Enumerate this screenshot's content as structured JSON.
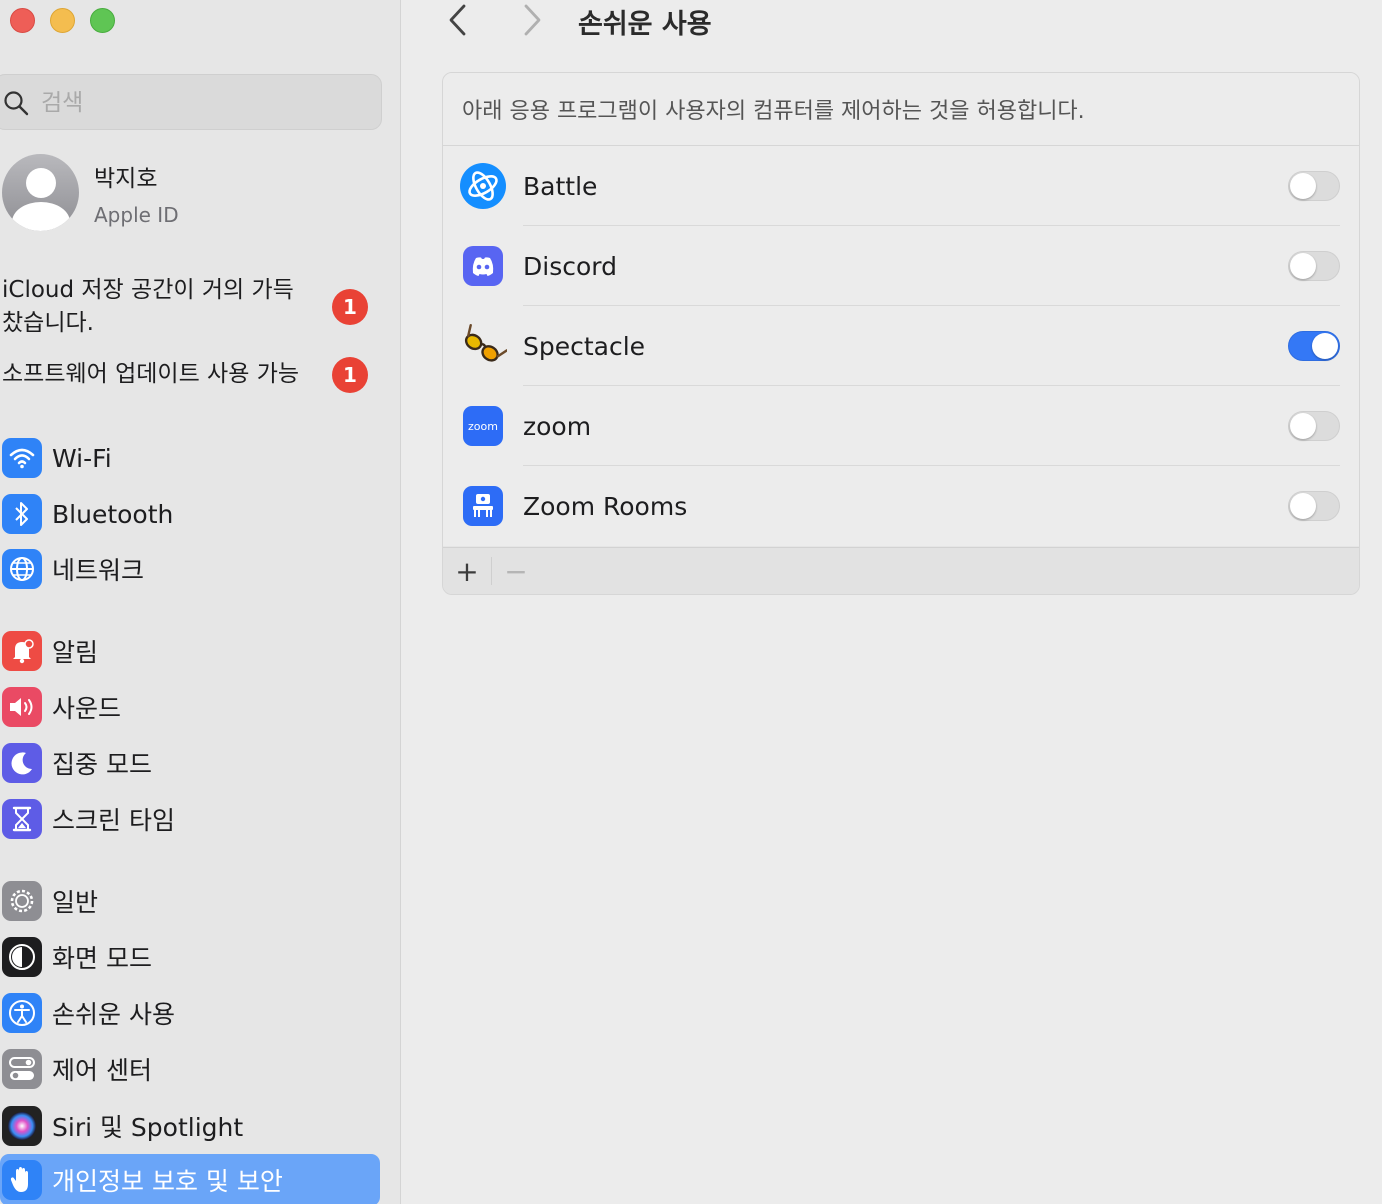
{
  "sidebar": {
    "search_placeholder": "검색",
    "account": {
      "name": "박지호",
      "subtitle": "Apple ID"
    },
    "notices": [
      {
        "label": "iCloud 저장 공간이 거의 가득 찼습니다.",
        "badge": "1"
      },
      {
        "label": "소프트웨어 업데이트 사용 가능",
        "badge": "1"
      }
    ],
    "items": [
      {
        "label": "Wi-Fi",
        "icon": "wifi-icon",
        "color": "#2f83f7"
      },
      {
        "label": "Bluetooth",
        "icon": "bluetooth-icon",
        "color": "#2f83f7"
      },
      {
        "label": "네트워크",
        "icon": "globe-icon",
        "color": "#2f83f7"
      },
      {
        "label": "알림",
        "icon": "bell-icon",
        "color": "#ee4b44"
      },
      {
        "label": "사운드",
        "icon": "speaker-icon",
        "color": "#ea4a64"
      },
      {
        "label": "집중 모드",
        "icon": "moon-icon",
        "color": "#5e5ce6"
      },
      {
        "label": "스크린 타임",
        "icon": "hourglass-icon",
        "color": "#5e5ce6"
      },
      {
        "label": "일반",
        "icon": "gear-icon",
        "color": "#8e8e93"
      },
      {
        "label": "화면 모드",
        "icon": "appearance-icon",
        "color": "#1d1d1f"
      },
      {
        "label": "손쉬운 사용",
        "icon": "accessibility-icon",
        "color": "#2f83f7"
      },
      {
        "label": "제어 센터",
        "icon": "control-center-icon",
        "color": "#8e8e93"
      },
      {
        "label": "Siri 및 Spotlight",
        "icon": "siri-icon",
        "color": "#222222"
      },
      {
        "label": "개인정보 보호 및 보안",
        "icon": "hand-icon",
        "color": "#2f83f7"
      }
    ],
    "selected_index": 12
  },
  "main": {
    "title": "손쉬운 사용",
    "description": "아래 응용 프로그램이 사용자의 컴퓨터를 제어하는 것을 허용합니다.",
    "apps": [
      {
        "name": "Battle",
        "icon": "battle-net-icon",
        "enabled": false
      },
      {
        "name": "Discord",
        "icon": "discord-icon",
        "enabled": false
      },
      {
        "name": "Spectacle",
        "icon": "spectacle-icon",
        "enabled": true
      },
      {
        "name": "zoom",
        "icon": "zoom-icon",
        "enabled": false
      },
      {
        "name": "Zoom Rooms",
        "icon": "zoom-rooms-icon",
        "enabled": false
      }
    ],
    "add_label": "+",
    "remove_label": "−",
    "zoom_icon_text": "zoom"
  },
  "colors": {
    "accent": "#3478f6",
    "selection": "#6aa5f8",
    "badge": "#e94235"
  }
}
